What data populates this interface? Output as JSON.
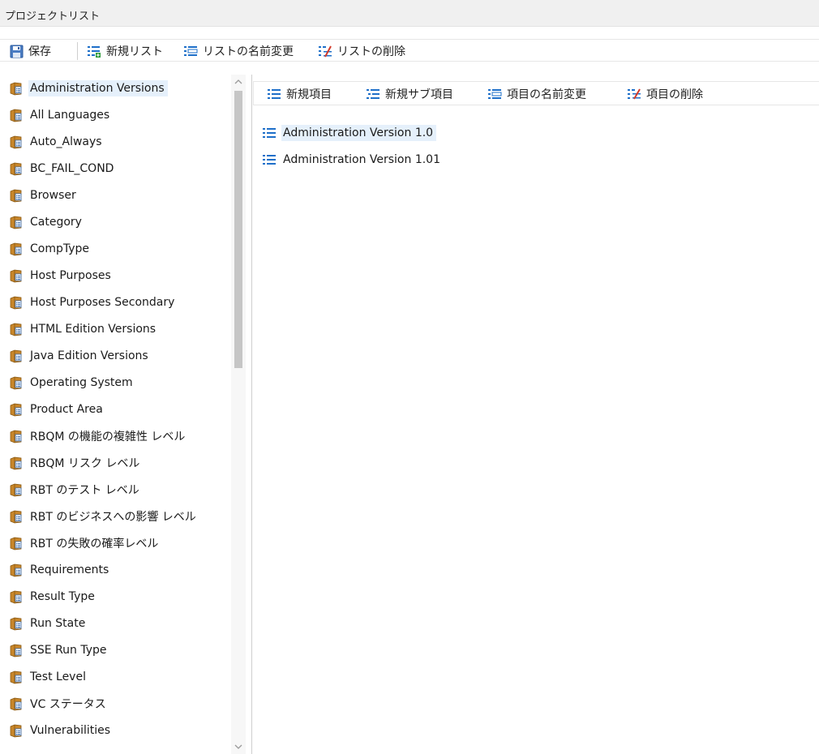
{
  "window": {
    "title": "プロジェクトリスト"
  },
  "toolbar": {
    "save": {
      "label": "保存",
      "icon": "save-icon"
    },
    "new_list": {
      "label": "新規リスト",
      "icon": "new-list-icon"
    },
    "rename_list": {
      "label": "リストの名前変更",
      "icon": "rename-list-icon"
    },
    "delete_list": {
      "label": "リストの削除",
      "icon": "delete-list-icon"
    }
  },
  "lists": {
    "selected": "Administration Versions",
    "items": [
      "Administration Versions",
      "All Languages",
      "Auto_Always",
      "BC_FAIL_COND",
      "Browser",
      "Category",
      "CompType",
      "Host Purposes",
      "Host Purposes Secondary",
      "HTML Edition Versions",
      "Java Edition Versions",
      "Operating System",
      "Product Area",
      "RBQM の機能の複雑性 レベル",
      "RBQM リスク レベル",
      "RBT のテスト レベル",
      "RBT のビジネスへの影響 レベル",
      "RBT の失敗の確率レベル",
      "Requirements",
      "Result Type",
      "Run State",
      "SSE Run Type",
      "Test Level",
      "VC ステータス",
      "Vulnerabilities"
    ]
  },
  "item_toolbar": {
    "new_item": {
      "label": "新規項目",
      "icon": "new-item-icon"
    },
    "new_sub_item": {
      "label": "新規サブ項目",
      "icon": "new-sub-item-icon"
    },
    "rename_item": {
      "label": "項目の名前変更",
      "icon": "rename-item-icon"
    },
    "delete_item": {
      "label": "項目の削除",
      "icon": "delete-item-icon"
    }
  },
  "list_values": {
    "selected": "Administration Version 1.0",
    "items": [
      "Administration Version 1.0",
      "Administration Version 1.01"
    ]
  },
  "colors": {
    "selection": "#e5f0fb",
    "icon_blue": "#1e6fc9",
    "icon_green": "#2e9b3a",
    "icon_red": "#d23a2a",
    "book_brown": "#c8862a"
  }
}
